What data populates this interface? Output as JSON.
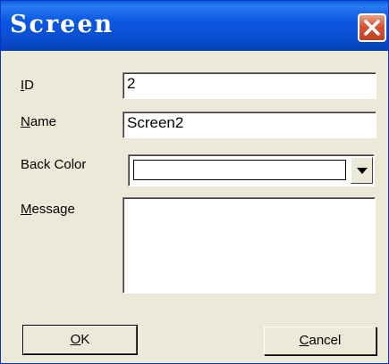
{
  "dialog": {
    "title": "Screen",
    "close_icon": "close-icon",
    "colors": {
      "titlebar": "#0a4fd2",
      "close": "#c3401f",
      "face": "#ece9d8"
    }
  },
  "fields": {
    "id": {
      "label_hotkey": "I",
      "label_rest": "D",
      "value": "2"
    },
    "name": {
      "label_hotkey": "N",
      "label_rest": "ame",
      "value": "Screen2"
    },
    "back_color": {
      "label": "Back Color",
      "value": ""
    },
    "message": {
      "label_hotkey": "M",
      "label_rest": "essage",
      "value": ""
    }
  },
  "buttons": {
    "ok": {
      "hotkey": "O",
      "rest": "K"
    },
    "cancel": {
      "hotkey": "C",
      "rest": "ancel"
    }
  },
  "icons": {
    "dropdown": "chevron-down-icon"
  }
}
